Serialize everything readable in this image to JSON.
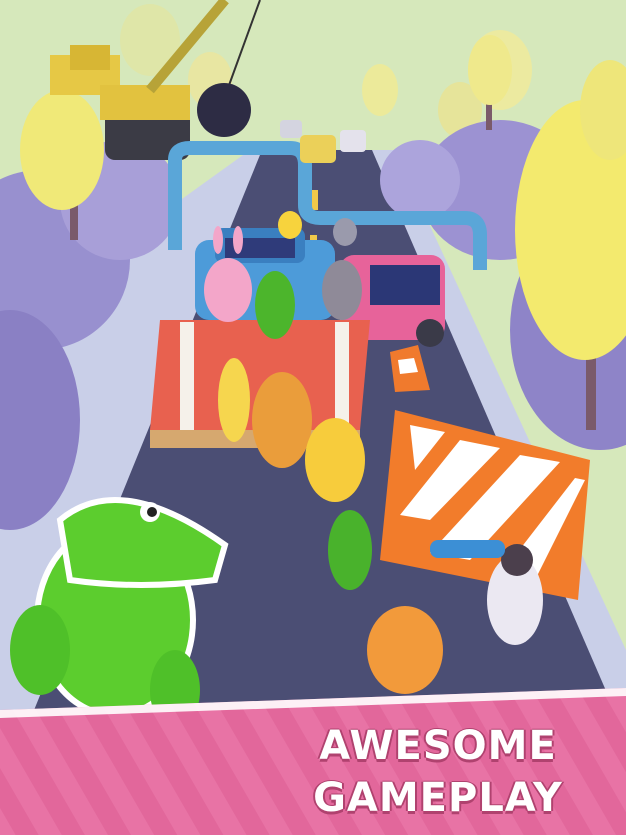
{
  "promo": {
    "headline_line1": "AWESOME",
    "headline_line2": "GAMEPLAY"
  },
  "palette": {
    "sky": "#d7e9b9",
    "road": "#4a4d73",
    "sidewalk": "#d9dff0",
    "tree_yellow": "#f2ea78",
    "tree_purple": "#9a8fd0",
    "crocodile": "#5ccd2e",
    "banner_pink": "#e2679b",
    "barrier_orange": "#f27c2b",
    "car_blue": "#4b9ad9",
    "car_pink": "#e8639a"
  },
  "characters": [
    {
      "name": "crocodile-skater",
      "icon": "crocodile-icon"
    },
    {
      "name": "pink-bunny",
      "icon": "bunny-icon"
    },
    {
      "name": "green-avocado",
      "icon": "avocado-icon"
    },
    {
      "name": "gray-cat",
      "icon": "cat-icon"
    },
    {
      "name": "yellow-duck",
      "icon": "duck-icon"
    },
    {
      "name": "orange-bear",
      "icon": "bear-icon"
    },
    {
      "name": "banana",
      "icon": "banana-icon"
    },
    {
      "name": "tiger",
      "icon": "tiger-icon"
    },
    {
      "name": "small-crocodile",
      "icon": "crocodile-icon"
    },
    {
      "name": "girl-skater",
      "icon": "person-icon"
    }
  ]
}
